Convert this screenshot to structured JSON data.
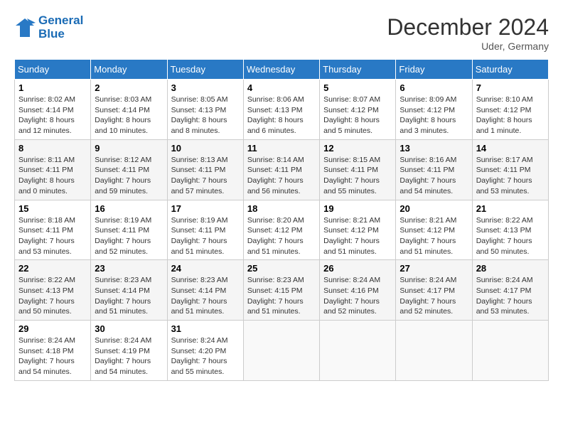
{
  "header": {
    "logo_line1": "General",
    "logo_line2": "Blue",
    "month": "December 2024",
    "location": "Uder, Germany"
  },
  "days_of_week": [
    "Sunday",
    "Monday",
    "Tuesday",
    "Wednesday",
    "Thursday",
    "Friday",
    "Saturday"
  ],
  "weeks": [
    [
      {
        "day": "1",
        "text": "Sunrise: 8:02 AM\nSunset: 4:14 PM\nDaylight: 8 hours\nand 12 minutes."
      },
      {
        "day": "2",
        "text": "Sunrise: 8:03 AM\nSunset: 4:14 PM\nDaylight: 8 hours\nand 10 minutes."
      },
      {
        "day": "3",
        "text": "Sunrise: 8:05 AM\nSunset: 4:13 PM\nDaylight: 8 hours\nand 8 minutes."
      },
      {
        "day": "4",
        "text": "Sunrise: 8:06 AM\nSunset: 4:13 PM\nDaylight: 8 hours\nand 6 minutes."
      },
      {
        "day": "5",
        "text": "Sunrise: 8:07 AM\nSunset: 4:12 PM\nDaylight: 8 hours\nand 5 minutes."
      },
      {
        "day": "6",
        "text": "Sunrise: 8:09 AM\nSunset: 4:12 PM\nDaylight: 8 hours\nand 3 minutes."
      },
      {
        "day": "7",
        "text": "Sunrise: 8:10 AM\nSunset: 4:12 PM\nDaylight: 8 hours\nand 1 minute."
      }
    ],
    [
      {
        "day": "8",
        "text": "Sunrise: 8:11 AM\nSunset: 4:11 PM\nDaylight: 8 hours\nand 0 minutes."
      },
      {
        "day": "9",
        "text": "Sunrise: 8:12 AM\nSunset: 4:11 PM\nDaylight: 7 hours\nand 59 minutes."
      },
      {
        "day": "10",
        "text": "Sunrise: 8:13 AM\nSunset: 4:11 PM\nDaylight: 7 hours\nand 57 minutes."
      },
      {
        "day": "11",
        "text": "Sunrise: 8:14 AM\nSunset: 4:11 PM\nDaylight: 7 hours\nand 56 minutes."
      },
      {
        "day": "12",
        "text": "Sunrise: 8:15 AM\nSunset: 4:11 PM\nDaylight: 7 hours\nand 55 minutes."
      },
      {
        "day": "13",
        "text": "Sunrise: 8:16 AM\nSunset: 4:11 PM\nDaylight: 7 hours\nand 54 minutes."
      },
      {
        "day": "14",
        "text": "Sunrise: 8:17 AM\nSunset: 4:11 PM\nDaylight: 7 hours\nand 53 minutes."
      }
    ],
    [
      {
        "day": "15",
        "text": "Sunrise: 8:18 AM\nSunset: 4:11 PM\nDaylight: 7 hours\nand 53 minutes."
      },
      {
        "day": "16",
        "text": "Sunrise: 8:19 AM\nSunset: 4:11 PM\nDaylight: 7 hours\nand 52 minutes."
      },
      {
        "day": "17",
        "text": "Sunrise: 8:19 AM\nSunset: 4:11 PM\nDaylight: 7 hours\nand 51 minutes."
      },
      {
        "day": "18",
        "text": "Sunrise: 8:20 AM\nSunset: 4:12 PM\nDaylight: 7 hours\nand 51 minutes."
      },
      {
        "day": "19",
        "text": "Sunrise: 8:21 AM\nSunset: 4:12 PM\nDaylight: 7 hours\nand 51 minutes."
      },
      {
        "day": "20",
        "text": "Sunrise: 8:21 AM\nSunset: 4:12 PM\nDaylight: 7 hours\nand 51 minutes."
      },
      {
        "day": "21",
        "text": "Sunrise: 8:22 AM\nSunset: 4:13 PM\nDaylight: 7 hours\nand 50 minutes."
      }
    ],
    [
      {
        "day": "22",
        "text": "Sunrise: 8:22 AM\nSunset: 4:13 PM\nDaylight: 7 hours\nand 50 minutes."
      },
      {
        "day": "23",
        "text": "Sunrise: 8:23 AM\nSunset: 4:14 PM\nDaylight: 7 hours\nand 51 minutes."
      },
      {
        "day": "24",
        "text": "Sunrise: 8:23 AM\nSunset: 4:14 PM\nDaylight: 7 hours\nand 51 minutes."
      },
      {
        "day": "25",
        "text": "Sunrise: 8:23 AM\nSunset: 4:15 PM\nDaylight: 7 hours\nand 51 minutes."
      },
      {
        "day": "26",
        "text": "Sunrise: 8:24 AM\nSunset: 4:16 PM\nDaylight: 7 hours\nand 52 minutes."
      },
      {
        "day": "27",
        "text": "Sunrise: 8:24 AM\nSunset: 4:17 PM\nDaylight: 7 hours\nand 52 minutes."
      },
      {
        "day": "28",
        "text": "Sunrise: 8:24 AM\nSunset: 4:17 PM\nDaylight: 7 hours\nand 53 minutes."
      }
    ],
    [
      {
        "day": "29",
        "text": "Sunrise: 8:24 AM\nSunset: 4:18 PM\nDaylight: 7 hours\nand 54 minutes."
      },
      {
        "day": "30",
        "text": "Sunrise: 8:24 AM\nSunset: 4:19 PM\nDaylight: 7 hours\nand 54 minutes."
      },
      {
        "day": "31",
        "text": "Sunrise: 8:24 AM\nSunset: 4:20 PM\nDaylight: 7 hours\nand 55 minutes."
      },
      {
        "day": "",
        "text": ""
      },
      {
        "day": "",
        "text": ""
      },
      {
        "day": "",
        "text": ""
      },
      {
        "day": "",
        "text": ""
      }
    ]
  ]
}
